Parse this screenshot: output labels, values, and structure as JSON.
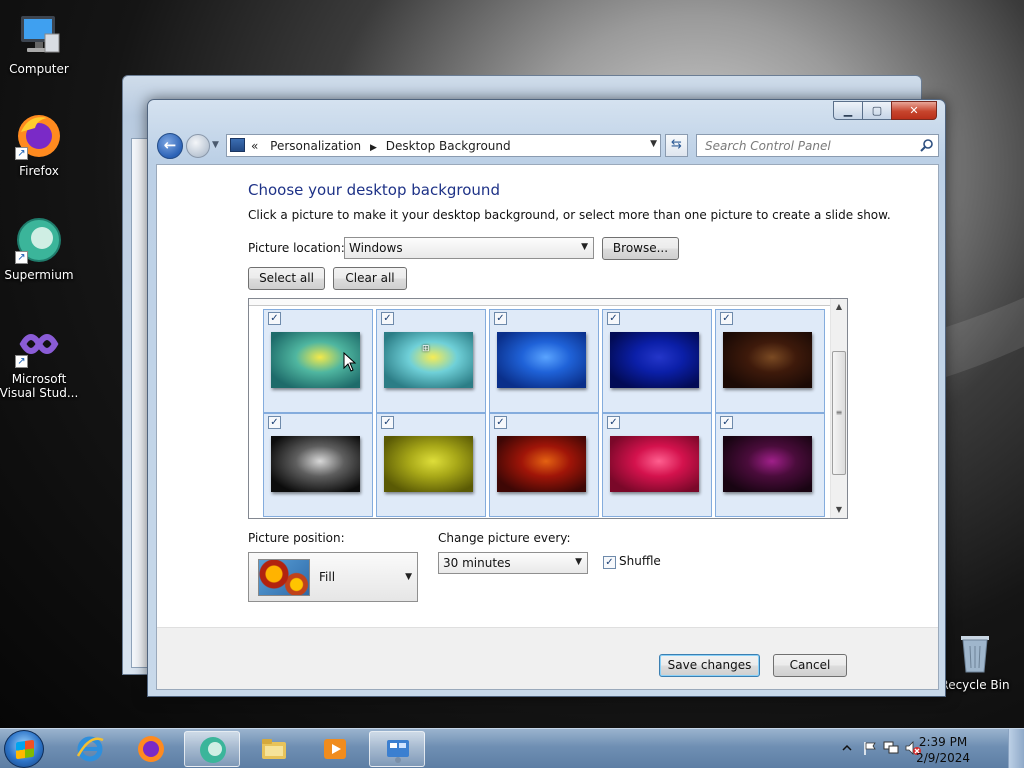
{
  "desktop": {
    "icons": [
      {
        "label": "Computer"
      },
      {
        "label": "Firefox"
      },
      {
        "label": "Supermium"
      },
      {
        "label": "Microsoft Visual Stud..."
      },
      {
        "label": "Recycle Bin"
      }
    ]
  },
  "window": {
    "caption": {
      "minimize": "▭",
      "maximize": "▭",
      "close": "✕"
    },
    "address": {
      "chevrons": "«",
      "crumbs": [
        "Personalization",
        "Desktop Background"
      ]
    },
    "search": {
      "placeholder": "Search Control Panel"
    },
    "heading": "Choose your desktop background",
    "description": "Click a picture to make it your desktop background, or select more than one picture to create a slide show.",
    "picture_location": {
      "label": "Picture location:",
      "value": "Windows",
      "browse": "Browse..."
    },
    "select_all": "Select all",
    "clear_all": "Clear all",
    "wallpapers": [
      {
        "name": "aurora-green",
        "checked": true,
        "colors": [
          "#1e6b6a",
          "#4fb6a0",
          "#f3e94a"
        ]
      },
      {
        "name": "vista-logo",
        "checked": true,
        "colors": [
          "#2c7d86",
          "#6fd0d8",
          "#f6ec55"
        ],
        "logo": "vista"
      },
      {
        "name": "blue",
        "checked": true,
        "colors": [
          "#0a2f8a",
          "#1f62d8",
          "#5aa4ff"
        ]
      },
      {
        "name": "dark-blue",
        "checked": true,
        "colors": [
          "#020b55",
          "#0b1fa8",
          "#2436c9"
        ]
      },
      {
        "name": "brown",
        "checked": true,
        "colors": [
          "#1b0a05",
          "#3e1a0b",
          "#7a4a23"
        ]
      },
      {
        "name": "silver",
        "checked": true,
        "colors": [
          "#0c0c0c",
          "#5e5e5e",
          "#d8d8d8"
        ]
      },
      {
        "name": "olive",
        "checked": true,
        "colors": [
          "#5a5a05",
          "#a8a818",
          "#dede3a"
        ]
      },
      {
        "name": "red-orange",
        "checked": true,
        "colors": [
          "#3e0705",
          "#a01508",
          "#e46212"
        ]
      },
      {
        "name": "pink",
        "checked": true,
        "colors": [
          "#7a0829",
          "#d4124d",
          "#ff5f8f"
        ]
      },
      {
        "name": "purple",
        "checked": true,
        "colors": [
          "#180412",
          "#4a0c3b",
          "#a0208a"
        ]
      }
    ],
    "picture_position": {
      "label": "Picture position:",
      "value": "Fill"
    },
    "change_picture": {
      "label": "Change picture every:",
      "value": "30 minutes"
    },
    "shuffle": {
      "label": "Shuffle",
      "checked": true
    },
    "save_changes": "Save changes",
    "cancel": "Cancel"
  },
  "taskbar": {
    "clock_time": "2:39 PM",
    "clock_date": "2/9/2024"
  }
}
